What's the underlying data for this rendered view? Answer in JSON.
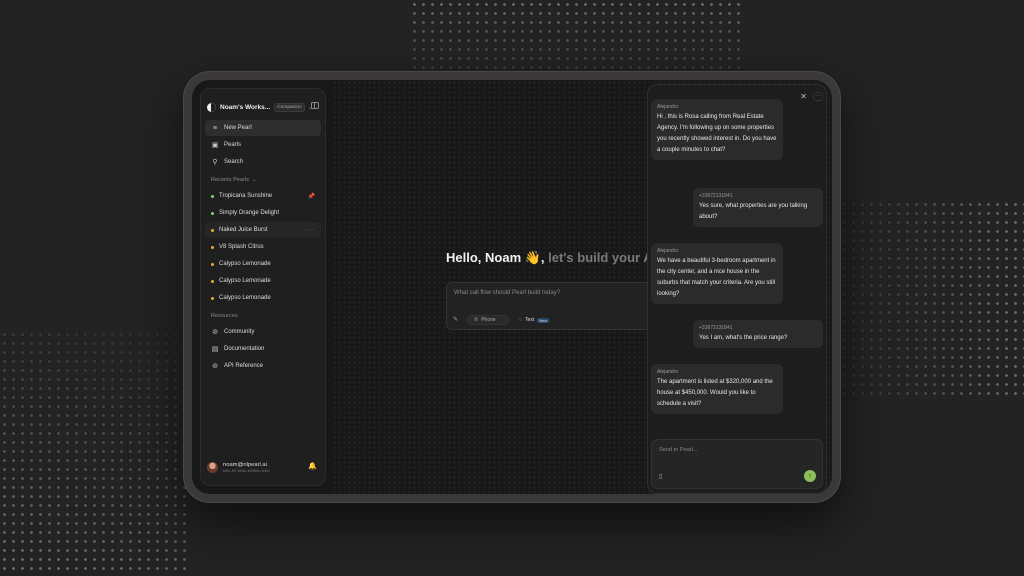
{
  "workspace": {
    "name": "Noam's Works...",
    "badge": "Companion"
  },
  "nav": {
    "new_pearl": "New Pearl",
    "pearls": "Pearls",
    "search": "Search"
  },
  "recents": {
    "label": "Recents Pearls",
    "items": [
      {
        "label": "Tropicana Sunshine",
        "color": "#7dd36a"
      },
      {
        "label": "Simply Orange Delight",
        "color": "#7dd36a"
      },
      {
        "label": "Naked Juice Burst",
        "color": "#f0a830"
      },
      {
        "label": "V8 Splash Citrus",
        "color": "#f0a830"
      },
      {
        "label": "Calypso Lemonade",
        "color": "#f0a830"
      },
      {
        "label": "Calypso Lemonade",
        "color": "#f0a830"
      },
      {
        "label": "Calypso Lemonade",
        "color": "#f0a830"
      }
    ]
  },
  "resources": {
    "label": "Resources",
    "community": "Community",
    "documentation": "Documentation",
    "api_reference": "API Reference"
  },
  "user": {
    "email": "noam@nlpearl.ai",
    "sub": "b8fc-4f7-b2db-b2f9bfc-9d0c"
  },
  "main": {
    "greeting_bold": "Hello, Noam 👋,",
    "greeting_rest": " let's build your AI v",
    "prompt_placeholder": "What call flow should Pearl build today?",
    "phone_label": "Phone",
    "text_label": "Text",
    "new_badge": "New"
  },
  "chat": {
    "messages": [
      {
        "from": "Alejandro",
        "text": "Hi , this is Rosa calling from Real Estate Agency. I'm following up on some properties you recently showed interest in. Do you have a couple minutes to chat?"
      },
      {
        "from": "+33672131841",
        "text": "Yes sure, what properties are you talking about?"
      },
      {
        "from": "Alejandro",
        "text": "We have a beautiful 3-bedroom apartment in the city center, and a nice house in the suburbs that match your criteria. Are you still looking?"
      },
      {
        "from": "+33672131841",
        "text": "Yes I am, what's the price range?"
      },
      {
        "from": "Alejandro",
        "text": "The apartment is listed at $320,000 and the house at $450,000. Would you like to schedule a visit?"
      }
    ],
    "composer_placeholder": "Send to Pearl..."
  }
}
